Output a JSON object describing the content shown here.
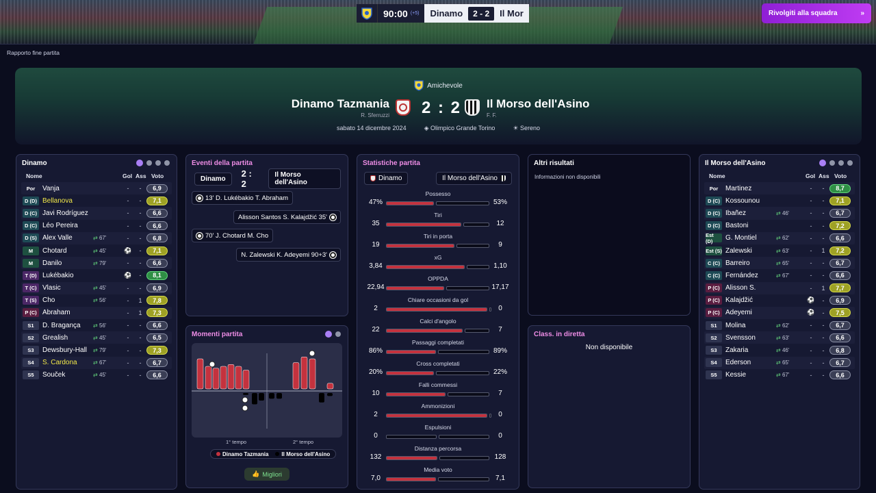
{
  "topbar": {
    "clock": "90:00",
    "added": "(+5)",
    "home_short": "Dinamo",
    "score": "2 - 2",
    "away_short": "Il Mor",
    "cta": "Rivolgiti alla squadra"
  },
  "breadcrumb": "Rapporto fine partita",
  "match": {
    "competition": "Amichevole",
    "home": "Dinamo Tazmania",
    "home_coach": "R. Sferruzzi",
    "away": "Il Morso dell'Asino",
    "away_coach": "F. F.",
    "score": "2 : 2",
    "date": "sabato 14 dicembre 2024",
    "stadium": "Olimpico Grande Torino",
    "weather": "Sereno"
  },
  "headers": {
    "name": "Nome",
    "goals": "Gol",
    "assists": "Ass",
    "rating": "Voto"
  },
  "home_roster": {
    "title": "Dinamo",
    "players": [
      {
        "pos": "Por",
        "cls": "gk",
        "name": "Vanja",
        "sub": "",
        "g": "-",
        "a": "-",
        "r": "6,9",
        "rc": "grey"
      },
      {
        "pos": "D (D)",
        "cls": "d",
        "name": "Bellanova",
        "hl": true,
        "sub": "",
        "g": "-",
        "a": "-",
        "r": "7,1",
        "rc": "yellow"
      },
      {
        "pos": "D (C)",
        "cls": "d",
        "name": "Javi Rodríguez",
        "sub": "",
        "g": "-",
        "a": "-",
        "r": "6,6",
        "rc": "grey"
      },
      {
        "pos": "D (C)",
        "cls": "d",
        "name": "Léo Pereira",
        "sub": "",
        "g": "-",
        "a": "-",
        "r": "6,6",
        "rc": "grey"
      },
      {
        "pos": "D (S)",
        "cls": "d",
        "name": "Alex Valle",
        "sub": "67'",
        "g": "-",
        "a": "-",
        "r": "6,8",
        "rc": "grey"
      },
      {
        "pos": "M",
        "cls": "m",
        "name": "Chotard",
        "sub": "45'",
        "g": "⚽",
        "a": "-",
        "r": "7,1",
        "rc": "yellow"
      },
      {
        "pos": "M",
        "cls": "m",
        "name": "Danilo",
        "sub": "79'",
        "g": "-",
        "a": "-",
        "r": "6,6",
        "rc": "grey"
      },
      {
        "pos": "T (D)",
        "cls": "t",
        "name": "Lukébakio",
        "sub": "",
        "g": "⚽",
        "a": "-",
        "r": "8,1",
        "rc": "green"
      },
      {
        "pos": "T (C)",
        "cls": "t",
        "name": "Vlasic",
        "sub": "45'",
        "g": "-",
        "a": "-",
        "r": "6,9",
        "rc": "grey"
      },
      {
        "pos": "T (S)",
        "cls": "t",
        "name": "Cho",
        "sub": "56'",
        "g": "-",
        "a": "1",
        "r": "7,8",
        "rc": "yellow"
      },
      {
        "pos": "P (C)",
        "cls": "p",
        "name": "Abraham",
        "sub": "",
        "g": "-",
        "a": "1",
        "r": "7,3",
        "rc": "yellow"
      },
      {
        "pos": "S1",
        "cls": "s",
        "name": "D. Bragança",
        "sub": "56'",
        "g": "-",
        "a": "-",
        "r": "6,6",
        "rc": "grey"
      },
      {
        "pos": "S2",
        "cls": "s",
        "name": "Grealish",
        "sub": "45'",
        "g": "-",
        "a": "-",
        "r": "6,5",
        "rc": "grey"
      },
      {
        "pos": "S3",
        "cls": "s",
        "name": "Dewsbury-Hall",
        "sub": "79'",
        "g": "-",
        "a": "-",
        "r": "7,3",
        "rc": "yellow"
      },
      {
        "pos": "S4",
        "cls": "s",
        "name": "S. Cardona",
        "hl": true,
        "sub": "67'",
        "g": "-",
        "a": "-",
        "r": "6,7",
        "rc": "grey"
      },
      {
        "pos": "S5",
        "cls": "s",
        "name": "Souček",
        "sub": "45'",
        "g": "-",
        "a": "-",
        "r": "6,6",
        "rc": "grey"
      }
    ]
  },
  "away_roster": {
    "title": "Il Morso dell'Asino",
    "players": [
      {
        "pos": "Por",
        "cls": "gk",
        "name": "Martinez",
        "sub": "",
        "g": "-",
        "a": "-",
        "r": "8,7",
        "rc": "green"
      },
      {
        "pos": "D (C)",
        "cls": "d",
        "name": "Kossounou",
        "sub": "",
        "g": "-",
        "a": "-",
        "r": "7,1",
        "rc": "yellow"
      },
      {
        "pos": "D (C)",
        "cls": "d",
        "name": "Ibañez",
        "sub": "46'",
        "g": "-",
        "a": "-",
        "r": "6,7",
        "rc": "grey"
      },
      {
        "pos": "D (C)",
        "cls": "d",
        "name": "Bastoni",
        "sub": "",
        "g": "-",
        "a": "-",
        "r": "7,2",
        "rc": "yellow"
      },
      {
        "pos": "Est (D)",
        "cls": "m",
        "name": "G. Montiel",
        "sub": "62'",
        "g": "-",
        "a": "-",
        "r": "6,6",
        "rc": "grey"
      },
      {
        "pos": "Est (S)",
        "cls": "m",
        "name": "Zalewski",
        "sub": "63'",
        "g": "-",
        "a": "1",
        "r": "7,2",
        "rc": "yellow"
      },
      {
        "pos": "C (C)",
        "cls": "d",
        "name": "Barreiro",
        "sub": "65'",
        "g": "-",
        "a": "-",
        "r": "6,7",
        "rc": "grey"
      },
      {
        "pos": "C (C)",
        "cls": "d",
        "name": "Fernández",
        "sub": "67'",
        "g": "-",
        "a": "-",
        "r": "6,6",
        "rc": "grey"
      },
      {
        "pos": "P (C)",
        "cls": "p",
        "name": "Alisson S.",
        "sub": "",
        "g": "-",
        "a": "1",
        "r": "7,7",
        "rc": "yellow"
      },
      {
        "pos": "P (C)",
        "cls": "p",
        "name": "Kalajdžić",
        "sub": "",
        "g": "⚽",
        "a": "-",
        "r": "6,9",
        "rc": "grey"
      },
      {
        "pos": "P (C)",
        "cls": "p",
        "name": "Adeyemi",
        "sub": "",
        "g": "⚽",
        "a": "-",
        "r": "7,5",
        "rc": "yellow"
      },
      {
        "pos": "S1",
        "cls": "s",
        "name": "Molina",
        "sub": "62'",
        "g": "-",
        "a": "-",
        "r": "6,7",
        "rc": "grey"
      },
      {
        "pos": "S2",
        "cls": "s",
        "name": "Svensson",
        "sub": "63'",
        "g": "-",
        "a": "-",
        "r": "6,6",
        "rc": "grey"
      },
      {
        "pos": "S3",
        "cls": "s",
        "name": "Zakaria",
        "sub": "46'",
        "g": "-",
        "a": "-",
        "r": "6,8",
        "rc": "grey"
      },
      {
        "pos": "S4",
        "cls": "s",
        "name": "Ederson",
        "sub": "65'",
        "g": "-",
        "a": "-",
        "r": "6,7",
        "rc": "grey"
      },
      {
        "pos": "S5",
        "cls": "s",
        "name": "Kessie",
        "sub": "67'",
        "g": "-",
        "a": "-",
        "r": "6,6",
        "rc": "grey"
      }
    ]
  },
  "events": {
    "title": "Eventi della partita",
    "home": "Dinamo",
    "score": "2 : 2",
    "away": "Il Morso dell'Asino",
    "items": [
      {
        "side": "home",
        "text": "13' D. Lukébakio T. Abraham"
      },
      {
        "side": "away",
        "text": "Alisson Santos S. Kalajdžić 35'"
      },
      {
        "side": "home",
        "text": "70' J. Chotard M. Cho"
      },
      {
        "side": "away",
        "text": "N. Zalewski K. Adeyemi 90+3'"
      }
    ]
  },
  "stats": {
    "title": "Statistiche partita",
    "home": "Dinamo",
    "away": "Il Morso dell'Asino",
    "rows": [
      {
        "label": "Possesso",
        "l": "47%",
        "r": "53%",
        "lv": 47,
        "rv": 53
      },
      {
        "label": "Tiri",
        "l": "35",
        "r": "12",
        "lv": 35,
        "rv": 12
      },
      {
        "label": "Tiri in porta",
        "l": "19",
        "r": "9",
        "lv": 19,
        "rv": 9
      },
      {
        "label": "xG",
        "l": "3,84",
        "r": "1,10",
        "lv": 3.84,
        "rv": 1.1
      },
      {
        "label": "OPPDA",
        "l": "22,94",
        "r": "17,17",
        "lv": 22.94,
        "rv": 17.17
      },
      {
        "label": "Chiare occasioni da gol",
        "l": "2",
        "r": "0",
        "lv": 2,
        "rv": 0
      },
      {
        "label": "Calci d'angolo",
        "l": "22",
        "r": "7",
        "lv": 22,
        "rv": 7
      },
      {
        "label": "Passaggi completati",
        "l": "86%",
        "r": "89%",
        "lv": 86,
        "rv": 89
      },
      {
        "label": "Cross completati",
        "l": "20%",
        "r": "22%",
        "lv": 20,
        "rv": 22
      },
      {
        "label": "Falli commessi",
        "l": "10",
        "r": "7",
        "lv": 10,
        "rv": 7
      },
      {
        "label": "Ammonizioni",
        "l": "2",
        "r": "0",
        "lv": 2,
        "rv": 0
      },
      {
        "label": "Espulsioni",
        "l": "0",
        "r": "0",
        "lv": 0,
        "rv": 0
      },
      {
        "label": "Distanza percorsa",
        "l": "132",
        "r": "128",
        "lv": 132,
        "rv": 128
      },
      {
        "label": "Media voto",
        "l": "7,0",
        "r": "7,1",
        "lv": 7.0,
        "rv": 7.1
      }
    ]
  },
  "other": {
    "title": "Altri risultati",
    "note": "Informazioni non disponibili"
  },
  "live": {
    "title": "Class. in diretta",
    "note": "Non disponibile"
  },
  "moments": {
    "title": "Momenti partita",
    "first": "1° tempo",
    "second": "2° tempo",
    "legend_home": "Dinamo Tazmania",
    "legend_away": "Il Morso dell'Asino",
    "best": "Migliori",
    "home_bars": [
      0.8,
      0.6,
      0.55,
      0.6,
      0.65,
      0.6,
      0.5,
      0,
      0,
      0,
      0,
      0.7,
      0.85,
      0.8,
      0,
      0.15
    ],
    "away_bars": [
      0,
      0,
      0,
      0,
      0,
      0,
      0.05,
      0.3,
      0.2,
      0.15,
      0.15,
      0,
      0,
      0,
      0.25,
      0.08
    ],
    "colors": {
      "home": "#c4323e",
      "away": "#000000"
    }
  }
}
